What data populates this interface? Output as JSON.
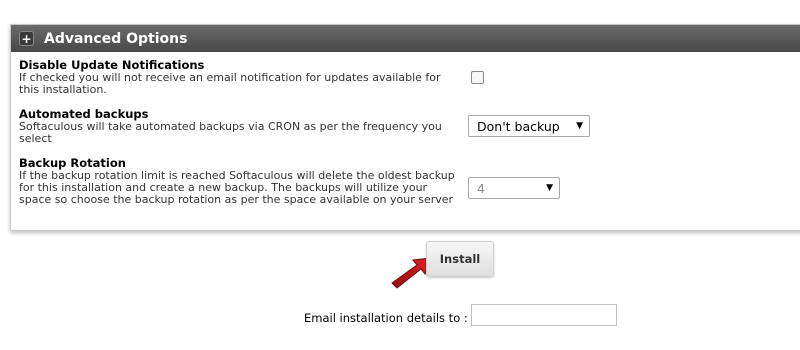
{
  "advanced_options": {
    "header_icon": "plus-icon",
    "title": "Advanced Options",
    "disable_update_notifications": {
      "title": "Disable Update Notifications",
      "description": "If checked you will not receive an email notification for updates available for this installation.",
      "checked": false
    },
    "automated_backups": {
      "title": "Automated backups",
      "description": "Softaculous will take automated backups via CRON as per the frequency you select",
      "selected": "Don't backup"
    },
    "backup_rotation": {
      "title": "Backup Rotation",
      "description": "If the backup rotation limit is reached Softaculous will delete the oldest backup for this installation and create a new backup. The backups will utilize your space so choose the backup rotation as per the space available on your server",
      "selected": "4",
      "disabled": true
    }
  },
  "install_button": {
    "label": "Install",
    "annotation_color": "#d0141a"
  },
  "email": {
    "label": "Email installation details to :",
    "value": ""
  }
}
